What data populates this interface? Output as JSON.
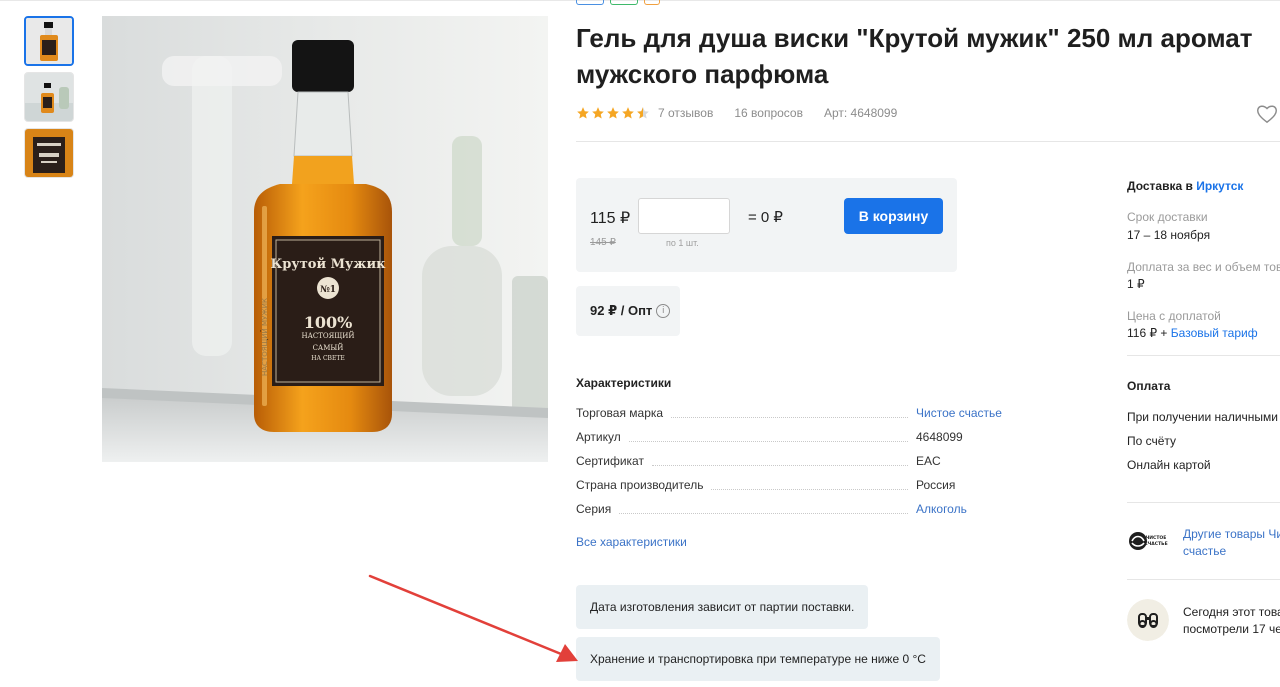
{
  "product": {
    "title": "Гель для душа виски \"Крутой мужик\" 250 мл аромат мужского парфюма",
    "rating": 4.5,
    "reviews": "7 отзывов",
    "questions": "16 вопросов",
    "article": "Арт: 4648099"
  },
  "price": {
    "current": "115 ₽",
    "old": "145 ₽",
    "qty_value": "",
    "per_unit": "по 1 шт.",
    "sum": "= 0 ₽",
    "cart_button": "В корзину",
    "opt": "92 ₽ / Опт",
    "info_glyph": "i"
  },
  "characteristics": {
    "title": "Характеристики",
    "rows": [
      {
        "key": "Торговая марка",
        "value": "Чистое счастье",
        "link": true
      },
      {
        "key": "Артикул",
        "value": "4648099",
        "link": false
      },
      {
        "key": "Сертификат",
        "value": "EAC",
        "link": false
      },
      {
        "key": "Страна производитель",
        "value": "Россия",
        "link": false
      },
      {
        "key": "Серия",
        "value": "Алкоголь",
        "link": true
      }
    ],
    "all_link": "Все характеристики"
  },
  "notes": {
    "manufacture": "Дата изготовления зависит от партии поставки.",
    "storage": "Хранение и транспортировка при температуре не ниже 0 °С"
  },
  "delivery": {
    "title": "Доставка в",
    "city": "Иркутск",
    "term_label": "Срок доставки",
    "term_value": "17 – 18 ноября",
    "surcharge_label": "Доплата за вес и объем това",
    "surcharge_value": "1 ₽",
    "price_label": "Цена с доплатой",
    "price_value": "116 ₽ +",
    "tariff_link": "Базовый тариф"
  },
  "payment": {
    "title": "Оплата",
    "methods": [
      "При получении наличными",
      "По счёту",
      "Онлайн картой"
    ]
  },
  "brand": {
    "logo_text": "ЧИСТОЕ СЧАСТЬЕ",
    "link_line1": "Другие товары Чи",
    "link_line2": "счастье"
  },
  "views": {
    "line1": "Сегодня этот това",
    "line2": "посмотрели 17 чел"
  },
  "image_label": {
    "brand": "Крутой Мужик",
    "no": "№1",
    "percent": "100%",
    "sub": "НАСТОЯЩИЙ",
    "samy": "САМЫЙ",
    "na_svete": "НА СВЕТЕ",
    "side": "НАСТОЯЩИЙ МУЖИК"
  },
  "colors": {
    "accent": "#1a73e8",
    "link": "#3b73c7",
    "star": "#f5a623",
    "annotation_arrow": "#e2403a"
  },
  "icons": [
    "star-icon",
    "heart-icon",
    "info-icon",
    "brand-logo-icon",
    "binoculars-icon",
    "arrow-annotation"
  ]
}
